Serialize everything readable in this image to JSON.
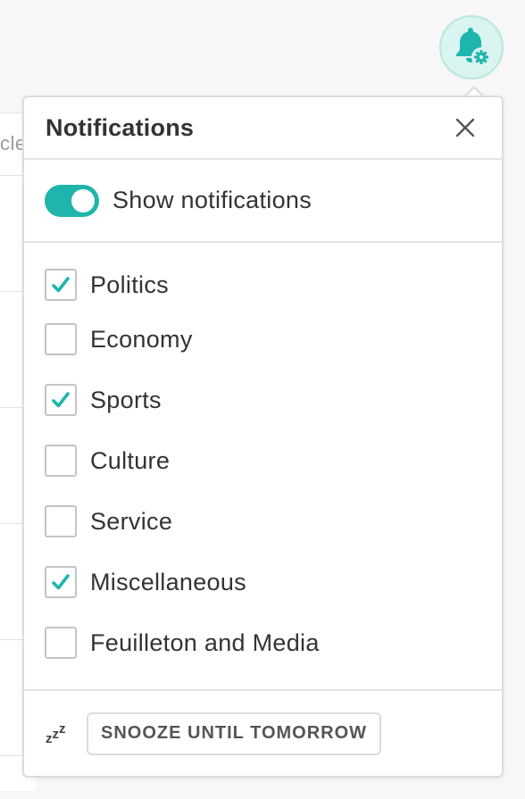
{
  "background": {
    "fragment_text": "cle"
  },
  "bell_button": {
    "icon": "bell-gear-icon",
    "accent": "#1fb5ac"
  },
  "popover": {
    "title": "Notifications",
    "close_icon": "close-icon",
    "toggle": {
      "label": "Show notifications",
      "on": true,
      "color": "#1fb5ac"
    },
    "categories": [
      {
        "label": "Politics",
        "checked": true
      },
      {
        "label": "Economy",
        "checked": false
      },
      {
        "label": "Sports",
        "checked": true
      },
      {
        "label": "Culture",
        "checked": false
      },
      {
        "label": "Service",
        "checked": false
      },
      {
        "label": "Miscellaneous",
        "checked": true
      },
      {
        "label": "Feuilleton and Media",
        "checked": false
      }
    ],
    "footer": {
      "snooze_icon": "zzz-icon",
      "snooze_label": "SNOOZE UNTIL TOMORROW"
    }
  }
}
